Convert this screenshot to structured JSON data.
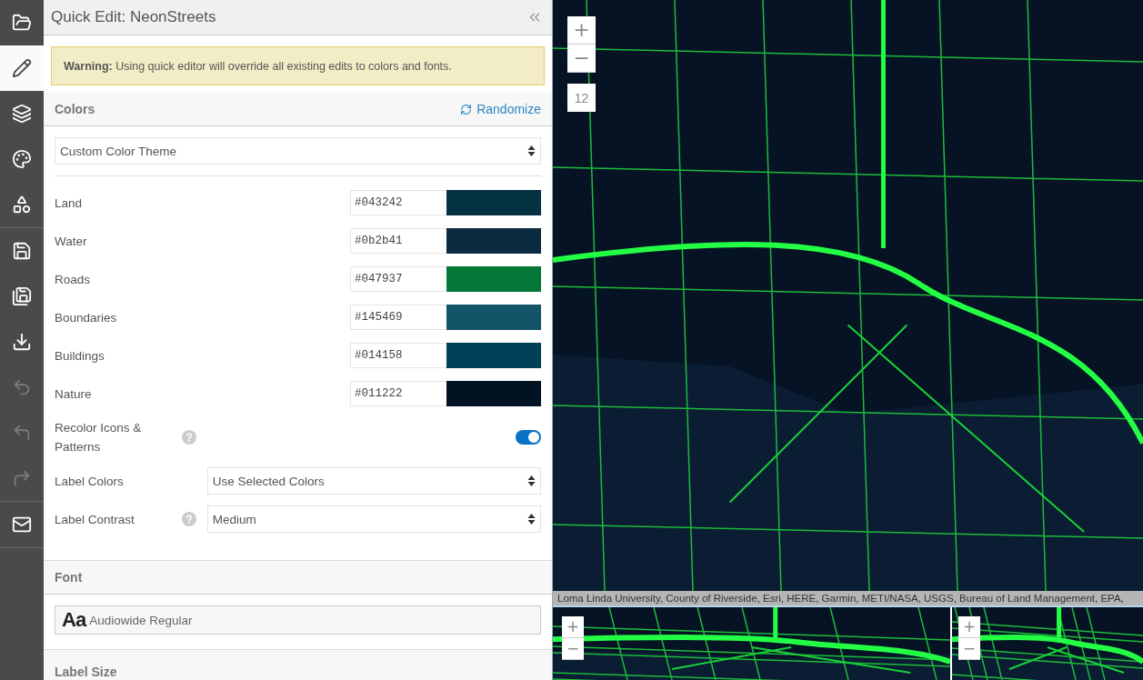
{
  "toolbar": {
    "groups": [
      {
        "items": [
          {
            "selected": false,
            "disabled": false
          },
          {
            "selected": true,
            "disabled": false
          },
          {
            "selected": false,
            "disabled": false
          },
          {
            "selected": false,
            "disabled": false
          },
          {
            "selected": false,
            "disabled": false
          }
        ]
      },
      {
        "items": [
          {
            "selected": false,
            "disabled": false
          },
          {
            "selected": false,
            "disabled": false
          },
          {
            "selected": false,
            "disabled": false
          },
          {
            "selected": false,
            "disabled": true
          },
          {
            "selected": false,
            "disabled": true
          },
          {
            "selected": false,
            "disabled": true
          }
        ]
      },
      {
        "items": [
          {
            "selected": false,
            "disabled": false
          }
        ]
      }
    ]
  },
  "panel": {
    "title": "Quick Edit: NeonStreets",
    "warning": "**Warning:** Using quick editor will override all existing edits to colors and fonts.",
    "colors": {
      "heading": "Colors",
      "randomize": "Randomize",
      "theme": "Custom Color Theme",
      "rows": [
        {
          "label": "Land",
          "value": "#043242",
          "color": "#043242"
        },
        {
          "label": "Water",
          "value": "#0b2b41",
          "color": "#0b2b41"
        },
        {
          "label": "Roads",
          "value": "#047937",
          "color": "#047937"
        },
        {
          "label": "Boundaries",
          "value": "#145469",
          "color": "#145469"
        },
        {
          "label": "Buildings",
          "value": "#014158",
          "color": "#014158"
        },
        {
          "label": "Nature",
          "value": "#011222",
          "color": "#011222"
        }
      ],
      "recolor": {
        "label": "Recolor Icons & Patterns",
        "on": true
      },
      "label_colors": {
        "label": "Label Colors",
        "value": "Use Selected Colors"
      },
      "label_contrast": {
        "label": "Label Contrast",
        "value": "Medium"
      }
    },
    "font": {
      "heading": "Font",
      "sample": "Aa",
      "value": "Audiowide Regular"
    },
    "label_size": {
      "heading": "Label Size"
    }
  },
  "map": {
    "zoom_in": "+",
    "zoom_out": "−",
    "zoom_level": "12",
    "attribution": "Loma Linda University, County of Riverside, Esri, HERE, Garmin, METI/NASA, USGS, Bureau of Land Management, EPA,",
    "previews": [
      {
        "zoom_in": "+",
        "zoom_out": "−"
      },
      {
        "zoom_in": "+",
        "zoom_out": "−"
      }
    ]
  }
}
